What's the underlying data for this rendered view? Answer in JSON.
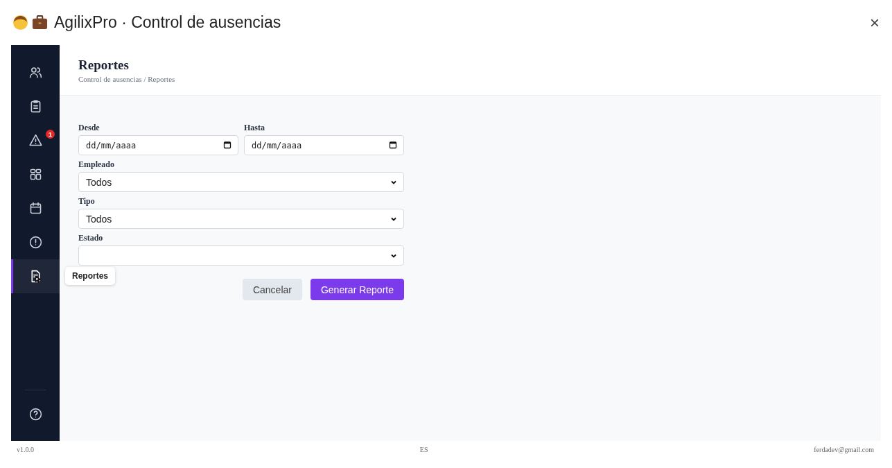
{
  "window": {
    "title": "AgilixPro · Control de ausencias",
    "close": "×"
  },
  "sidebar": {
    "items": [
      {
        "kind": "users",
        "selected": false
      },
      {
        "kind": "clipboard",
        "selected": false
      },
      {
        "kind": "alert",
        "selected": false,
        "badge": "1"
      },
      {
        "kind": "grid",
        "selected": false
      },
      {
        "kind": "calendar",
        "selected": false
      },
      {
        "kind": "info",
        "selected": false
      },
      {
        "kind": "report",
        "selected": true
      }
    ],
    "bottom_items": [
      {
        "kind": "help",
        "selected": false
      }
    ],
    "tooltip": "Reportes"
  },
  "header": {
    "title": "Reportes",
    "breadcrumb": "Control de ausencias / Reportes"
  },
  "form": {
    "dates": [
      {
        "label": "Desde",
        "placeholder": "dd/mm/aaaa"
      },
      {
        "label": "Hasta",
        "placeholder": "dd/mm/aaaa"
      }
    ],
    "selects": [
      {
        "label": "Empleado",
        "value": "Todos"
      },
      {
        "label": "Tipo",
        "value": "Todos"
      },
      {
        "label": "Estado"
      }
    ],
    "buttons": [
      {
        "label": "Cancelar",
        "kind": "secondary"
      },
      {
        "label": "Generar Reporte",
        "kind": "primary"
      }
    ]
  },
  "status_bar": {
    "version": "v1.0.0",
    "language": "ES",
    "user": "ferdadev@gmail.com"
  }
}
